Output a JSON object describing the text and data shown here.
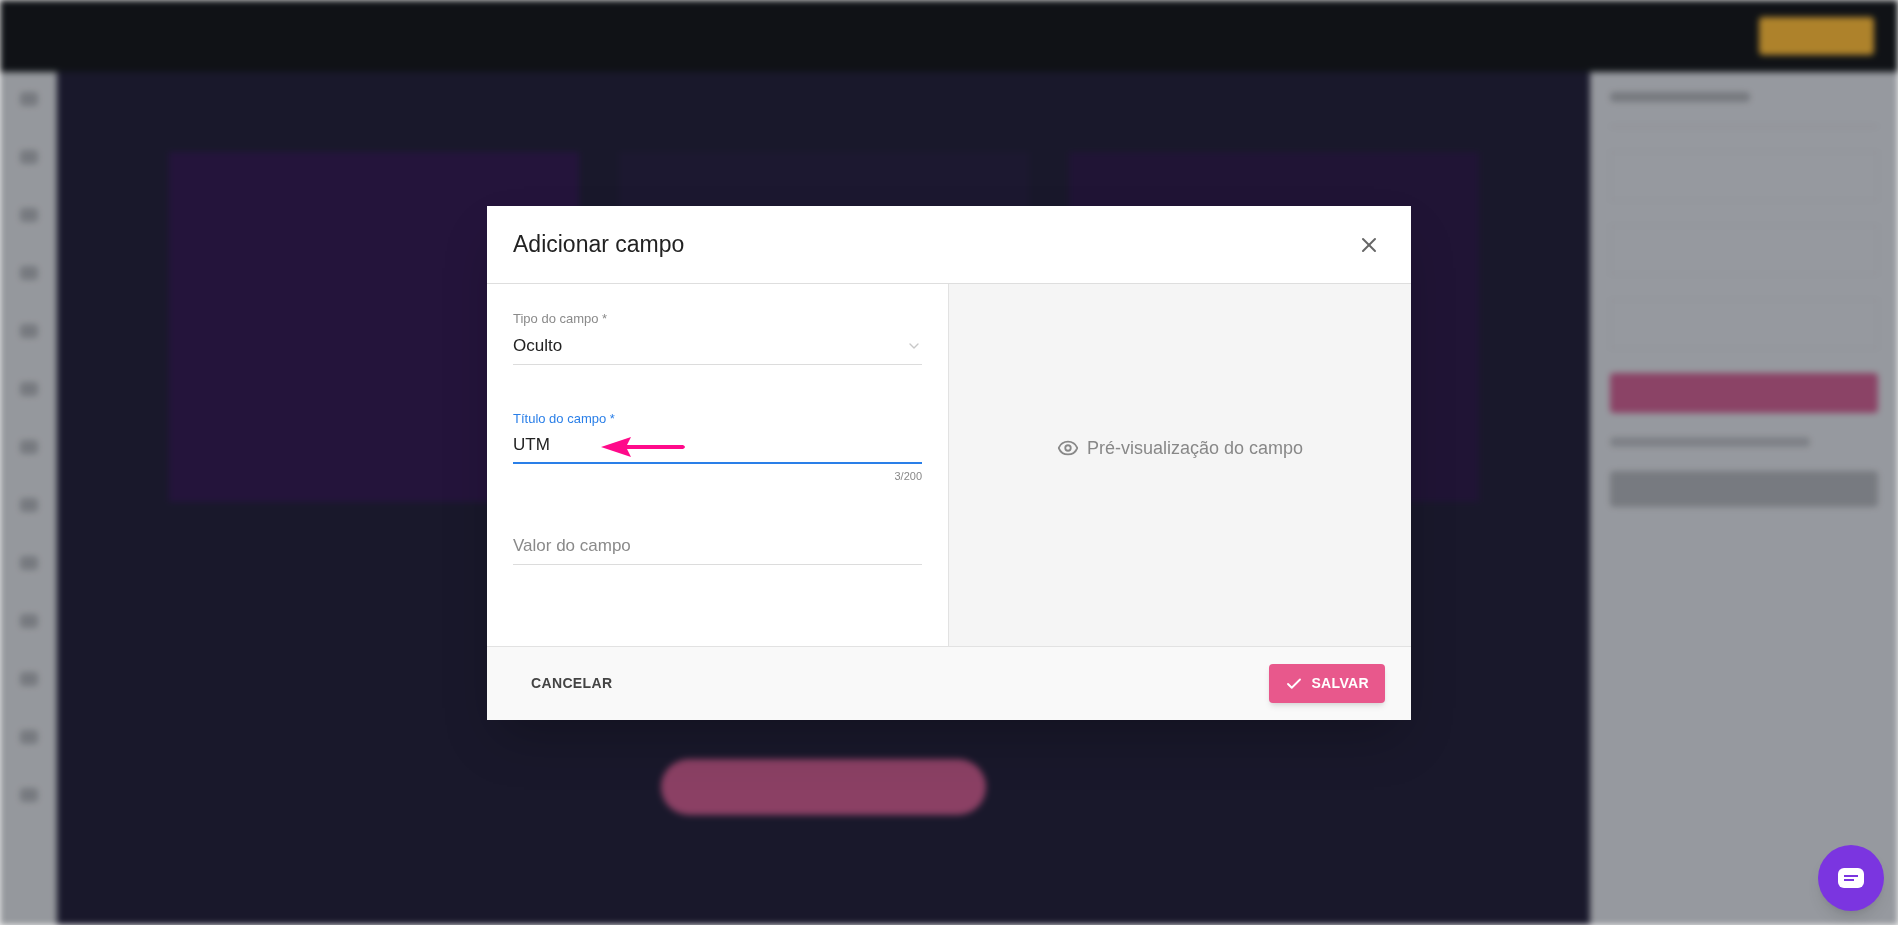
{
  "dialog": {
    "title": "Adicionar campo",
    "fields": [
      {
        "kind": "select",
        "label": "Tipo do campo *",
        "value": "Oculto",
        "focused": false
      },
      {
        "kind": "text",
        "label": "Título do campo *",
        "value": "UTM",
        "counter": "3/200",
        "focused": true
      },
      {
        "kind": "text",
        "placeholder": "Valor do campo",
        "focused": false
      }
    ],
    "preview": "Pré-visualização do campo",
    "buttons": [
      {
        "kind": "cancel",
        "label": "CANCELAR"
      },
      {
        "kind": "save",
        "label": "SALVAR"
      }
    ]
  }
}
